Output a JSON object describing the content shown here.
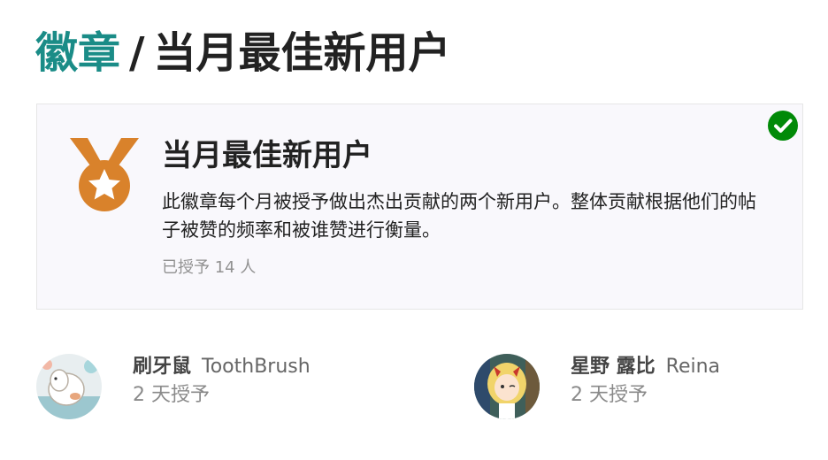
{
  "header": {
    "breadcrumb_root": "徽章",
    "separator": "/",
    "current": "当月最佳新用户"
  },
  "badge": {
    "icon": "medal-star-icon",
    "name": "当月最佳新用户",
    "description": "此徽章每个月被授予做出杰出贡献的两个新用户。整体贡献根据他们的帖子被赞的频率和被谁赞进行衡量。",
    "granted_count": "已授予 14 人",
    "owned_indicator": "check-circle-icon",
    "colors": {
      "medal": "#d9822b",
      "check": "#018a08",
      "accent": "#1a8c87"
    }
  },
  "grants": [
    {
      "username": "刷牙鼠",
      "nickname": "ToothBrush",
      "granted": "2 天授予",
      "avatar": "avatar-icon"
    },
    {
      "username": "星野 露比",
      "nickname": "Reina",
      "granted": "2 天授予",
      "avatar": "avatar-icon"
    }
  ]
}
